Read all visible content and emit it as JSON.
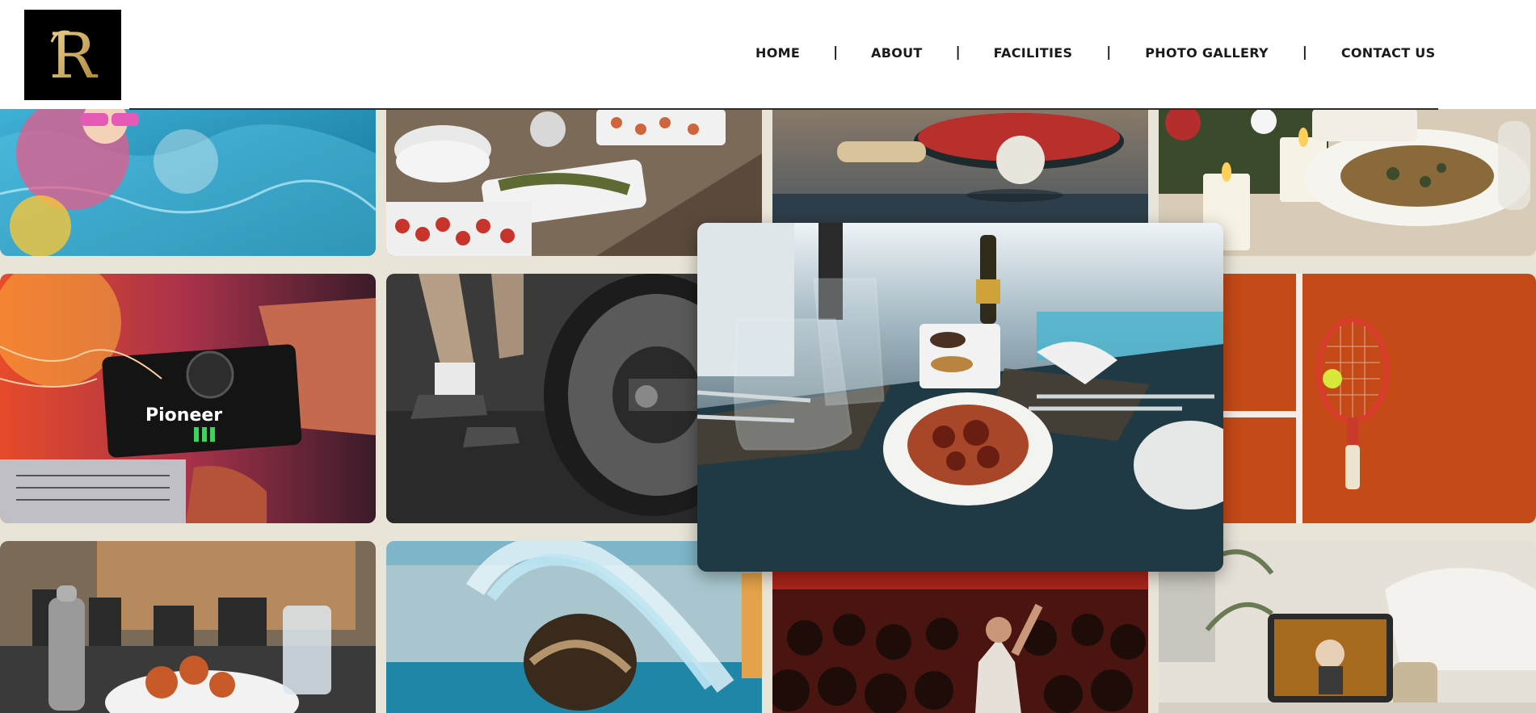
{
  "header": {
    "logo_letter": "R",
    "logo_icon": "ornate-r-logo",
    "nav": [
      {
        "label": "HOME"
      },
      {
        "label": "ABOUT"
      },
      {
        "label": "FACILITIES"
      },
      {
        "label": "PHOTO GALLERY"
      },
      {
        "label": "CONTACT US"
      }
    ],
    "separator": "|"
  },
  "gallery": {
    "tiles": [
      {
        "subject": "child-in-pool-photo"
      },
      {
        "subject": "buffet-food-photo"
      },
      {
        "subject": "table-tennis-photo"
      },
      {
        "subject": "candlelit-dinner-photo"
      },
      {
        "subject": "dj-console-photo"
      },
      {
        "subject": "barbell-gym-photo"
      },
      {
        "subject": "tennis-court-photo"
      },
      {
        "subject": "restaurant-table-photo"
      },
      {
        "subject": "pool-hair-splash-photo"
      },
      {
        "subject": "concert-crowd-photo"
      },
      {
        "subject": "bedroom-laptop-photo"
      }
    ],
    "featured": {
      "subject": "poolside-dining-photo"
    },
    "dj_brand_text": "Pioneer"
  },
  "colors": {
    "page_bg": "#e9e4d8",
    "header_bg": "#ffffff",
    "nav_text": "#1a1a1a",
    "logo_bg": "#000000",
    "logo_gold": "#c9a24b"
  }
}
